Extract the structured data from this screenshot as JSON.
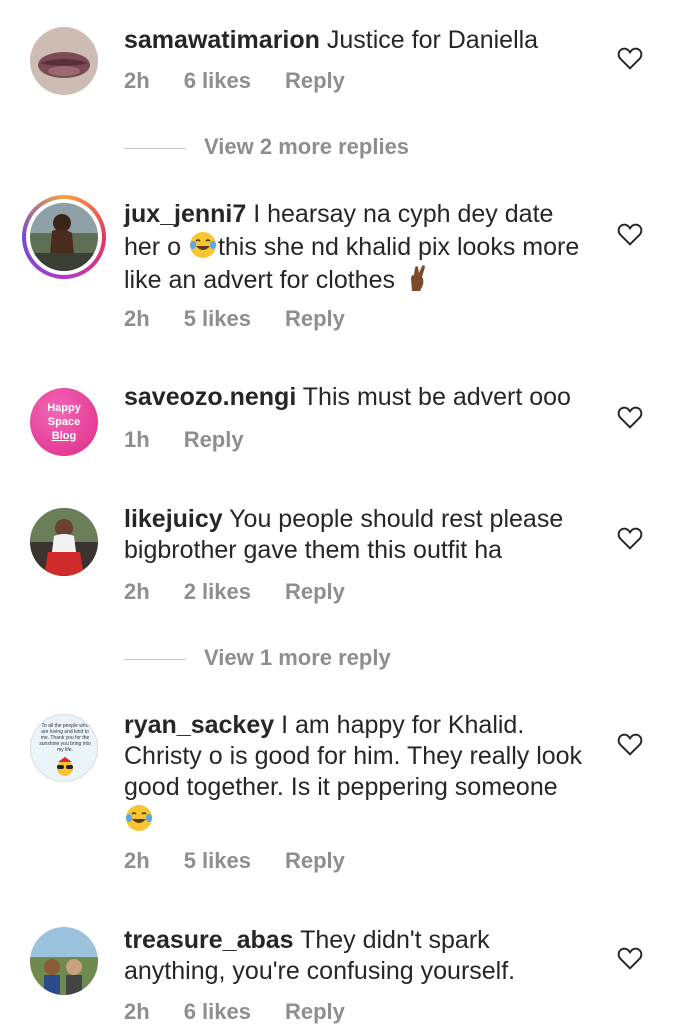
{
  "comments": [
    {
      "username": "samawatimarion",
      "text": "Justice for Daniella",
      "time": "2h",
      "likes": "6 likes",
      "reply": "Reply"
    },
    {
      "username": "jux_jenni7",
      "text_a": "I hearsay na cyph dey date her o ",
      "text_b": "this she nd khalid pix looks more like an advert for clothes ",
      "time": "2h",
      "likes": "5 likes",
      "reply": "Reply"
    },
    {
      "username": "saveozo.nengi",
      "text": "This must be advert ooo",
      "time": "1h",
      "reply": "Reply",
      "avatar_text": [
        "Happy",
        "Space",
        "Blog"
      ]
    },
    {
      "username": "likejuicy",
      "text": "You people should rest please bigbrother gave them this outfit ha",
      "time": "2h",
      "likes": "2 likes",
      "reply": "Reply"
    },
    {
      "username": "ryan_sackey",
      "text": "I am happy for Khalid. Christy o is good for him. They really look good together. Is it peppering someone ",
      "time": "2h",
      "likes": "5 likes",
      "reply": "Reply",
      "avatar_text": "To all the people who are loving and kind to me. Thank you for the sunshine you bring into my life."
    },
    {
      "username": "treasure_abas",
      "text": "They didn't spark anything, you're confusing yourself.",
      "time": "2h",
      "likes": "6 likes",
      "reply": "Reply"
    }
  ],
  "view_replies": [
    "View 2 more replies",
    "View 1 more reply"
  ],
  "icons": {
    "heart": "heart-outline-icon",
    "laugh": "tears-of-joy-emoji",
    "fingers": "crossed-fingers-emoji"
  },
  "colors": {
    "text": "#262626",
    "meta": "#8e8e8e",
    "pink": "#e8338f"
  }
}
